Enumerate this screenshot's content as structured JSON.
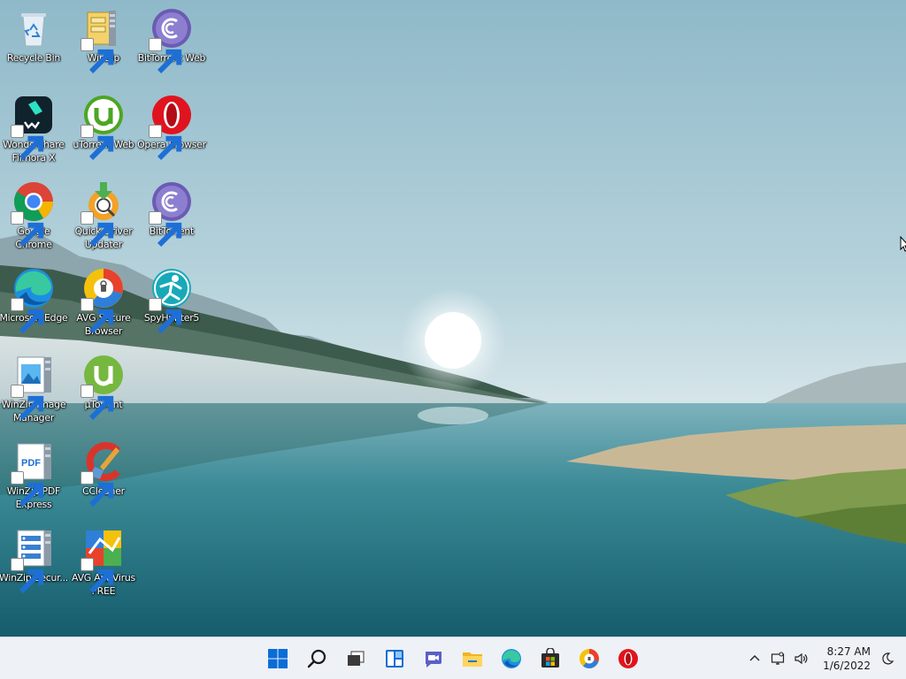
{
  "desktop": {
    "icons": [
      {
        "label": "Recycle Bin",
        "icon": "recycle-bin-icon",
        "shortcut": false
      },
      {
        "label": "WinZip",
        "icon": "winzip-icon",
        "shortcut": true
      },
      {
        "label": "BitTorrent Web",
        "icon": "bittorrent-web-icon",
        "shortcut": true
      },
      {
        "label": "Wondershare Filmora X",
        "icon": "filmora-icon",
        "shortcut": true
      },
      {
        "label": "uTorrent Web",
        "icon": "utorrent-web-icon",
        "shortcut": true
      },
      {
        "label": "Opera Browser",
        "icon": "opera-icon",
        "shortcut": true
      },
      {
        "label": "Google Chrome",
        "icon": "chrome-icon",
        "shortcut": true
      },
      {
        "label": "Quick Driver Updater",
        "icon": "quick-driver-updater-icon",
        "shortcut": true
      },
      {
        "label": "BitTorrent",
        "icon": "bittorrent-icon",
        "shortcut": true
      },
      {
        "label": "Microsoft Edge",
        "icon": "edge-icon",
        "shortcut": true
      },
      {
        "label": "AVG Secure Browser",
        "icon": "avg-secure-browser-icon",
        "shortcut": true
      },
      {
        "label": "SpyHunter5",
        "icon": "spyhunter-icon",
        "shortcut": true
      },
      {
        "label": "WinZip Image Manager",
        "icon": "winzip-image-manager-icon",
        "shortcut": true
      },
      {
        "label": "µTorrent",
        "icon": "utorrent-icon",
        "shortcut": true
      },
      {
        "label": "WinZip PDF Express",
        "icon": "winzip-pdf-express-icon",
        "shortcut": true
      },
      {
        "label": "CCleaner",
        "icon": "ccleaner-icon",
        "shortcut": true
      },
      {
        "label": "WinZip Secur...",
        "icon": "winzip-secure-backup-icon",
        "shortcut": true
      },
      {
        "label": "AVG AntiVirus FREE",
        "icon": "avg-antivirus-icon",
        "shortcut": true
      }
    ]
  },
  "taskbar": {
    "pinned": [
      {
        "name": "start-button",
        "icon": "windows-logo-icon"
      },
      {
        "name": "search-button",
        "icon": "search-icon"
      },
      {
        "name": "task-view-button",
        "icon": "task-view-icon"
      },
      {
        "name": "widgets-button",
        "icon": "widgets-icon"
      },
      {
        "name": "chat-button",
        "icon": "teams-chat-icon"
      },
      {
        "name": "file-explorer-button",
        "icon": "folder-icon"
      },
      {
        "name": "edge-taskbar-button",
        "icon": "edge-icon"
      },
      {
        "name": "store-button",
        "icon": "store-icon"
      },
      {
        "name": "avg-browser-taskbar-button",
        "icon": "avg-secure-browser-icon"
      },
      {
        "name": "opera-taskbar-button",
        "icon": "opera-icon"
      }
    ],
    "tray": {
      "overflow_icon": "chevron-up-icon",
      "network_icon": "network-icon",
      "volume_icon": "volume-icon",
      "time": "8:27 AM",
      "date": "1/6/2022",
      "focus_icon": "moon-icon"
    }
  },
  "colors": {
    "taskbar_bg": "#eef1f6",
    "accent": "#0a6cd6"
  }
}
